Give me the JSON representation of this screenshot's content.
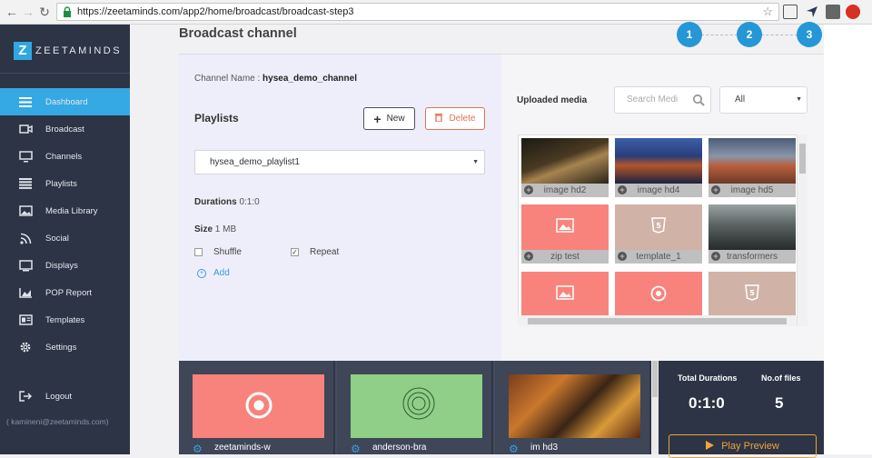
{
  "browser": {
    "url": "https://zeetaminds.com/app2/home/broadcast/broadcast-step3"
  },
  "sidebar": {
    "logo_mark": "Z",
    "logo_text": "ZEETAMINDS",
    "items": [
      {
        "label": "Dashboard",
        "icon": "menu-icon"
      },
      {
        "label": "Broadcast",
        "icon": "broadcast-icon"
      },
      {
        "label": "Channels",
        "icon": "monitor-icon"
      },
      {
        "label": "Playlists",
        "icon": "list-icon"
      },
      {
        "label": "Media Library",
        "icon": "image-icon"
      },
      {
        "label": "Social",
        "icon": "rss-icon"
      },
      {
        "label": "Displays",
        "icon": "display-icon"
      },
      {
        "label": "POP Report",
        "icon": "chart-icon"
      },
      {
        "label": "Templates",
        "icon": "template-icon"
      },
      {
        "label": "Settings",
        "icon": "gear-icon"
      }
    ],
    "logout_label": "Logout",
    "user_email": "( kamineni@zeetaminds.com)"
  },
  "header": {
    "title": "Broadcast channel",
    "steps": [
      "1",
      "2",
      "3"
    ]
  },
  "left": {
    "channel_label": "Channel Name : ",
    "channel_value": "hysea_demo_channel",
    "playlists_label": "Playlists",
    "new_label": "New",
    "delete_label": "Delete",
    "playlist_selected": "hysea_demo_playlist1",
    "durations_label": "Durations",
    "durations_value": "0:1:0",
    "size_label": "Size",
    "size_value": "1 MB",
    "shuffle_label": "Shuffle",
    "repeat_label": "Repeat",
    "add_label": "Add"
  },
  "right": {
    "uploaded_label": "Uploaded media",
    "search_placeholder": "Search Medi",
    "filter_value": "All",
    "media": [
      {
        "name": "image hd2"
      },
      {
        "name": "image hd4"
      },
      {
        "name": "image hd5"
      },
      {
        "name": "zip test"
      },
      {
        "name": "template_1"
      },
      {
        "name": "transformers"
      },
      {
        "name": ""
      },
      {
        "name": ""
      },
      {
        "name": ""
      }
    ]
  },
  "tray": {
    "items": [
      {
        "name": "zeetaminds-w"
      },
      {
        "name": "anderson-bra"
      },
      {
        "name": "im hd3"
      }
    ],
    "total_label": "Total Durations",
    "total_value": "0:1:0",
    "files_label": "No.of files",
    "files_value": "5",
    "play_label": "Play Preview"
  },
  "colors": {
    "accent": "#35a9e3",
    "sidebar_bg": "#2c3445",
    "delete": "#e57054",
    "play": "#f0a33a"
  }
}
